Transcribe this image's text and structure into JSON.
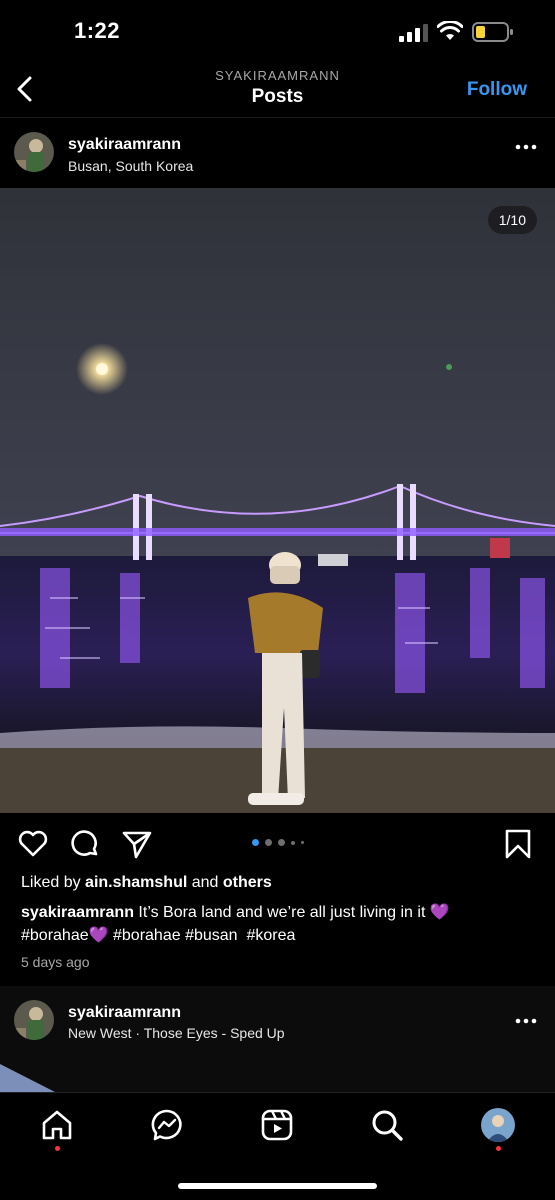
{
  "status_bar": {
    "time": "1:22"
  },
  "header": {
    "account": "SYAKIRAAMRANN",
    "title": "Posts",
    "follow_label": "Follow"
  },
  "post": {
    "username": "syakiraamrann",
    "location": "Busan, South Korea",
    "media_counter": "1/10",
    "liked_prefix": "Liked by",
    "liked_user": "ain.shamshul",
    "liked_and": "and",
    "liked_others": "others",
    "caption_user": "syakiraamrann",
    "caption_text": "It’s Bora land and we’re all just living in it",
    "caption_heart": "💜",
    "caption_tag1": "#borahae",
    "caption_heart2": "💜",
    "caption_tags_rest": "#borahae #busan  #korea",
    "time_ago": "5 days ago",
    "carousel": {
      "total_visible_dots": 5,
      "active_index": 0
    }
  },
  "next_post": {
    "username": "syakiraamrann",
    "audio": "New West · Those Eyes - Sped Up"
  },
  "colors": {
    "accent": "#3797f0",
    "bridge_light": "#b77cff",
    "notification": "#ff3040"
  },
  "icons": [
    "back-icon",
    "more-icon",
    "heart-icon",
    "comment-icon",
    "share-icon",
    "bookmark-icon",
    "home-icon",
    "messenger-icon",
    "reels-icon",
    "search-icon",
    "profile-avatar"
  ]
}
